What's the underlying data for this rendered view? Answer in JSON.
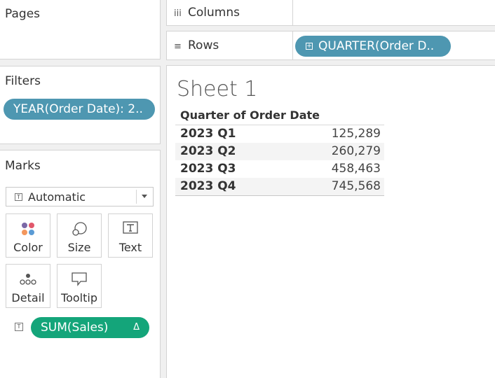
{
  "pages": {
    "title": "Pages"
  },
  "filters": {
    "title": "Filters",
    "pill": "YEAR(Order Date): 2.."
  },
  "marks": {
    "title": "Marks",
    "mark_type": "Automatic",
    "buttons": [
      {
        "label": "Color",
        "icon": "color-dots-icon"
      },
      {
        "label": "Size",
        "icon": "size-circles-icon"
      },
      {
        "label": "Text",
        "icon": "text-t-icon"
      },
      {
        "label": "Detail",
        "icon": "detail-dots-icon"
      },
      {
        "label": "Tooltip",
        "icon": "tooltip-bubble-icon"
      }
    ],
    "field_pill": {
      "label": "SUM(Sales)",
      "delta": "Δ"
    }
  },
  "shelves": {
    "columns": {
      "label": "Columns",
      "symbol": "iii"
    },
    "rows": {
      "label": "Rows",
      "symbol": "≡",
      "pill": "QUARTER(Order D.."
    }
  },
  "view": {
    "sheet_title": "Sheet 1",
    "column_header": "Quarter of Order Date",
    "rows": [
      {
        "quarter": "2023 Q1",
        "value": "125,289"
      },
      {
        "quarter": "2023 Q2",
        "value": "260,279"
      },
      {
        "quarter": "2023 Q3",
        "value": "458,463"
      },
      {
        "quarter": "2023 Q4",
        "value": "745,568"
      }
    ]
  },
  "colors": {
    "discrete_pill": "#4e97b1",
    "measure_pill": "#14a57a"
  }
}
